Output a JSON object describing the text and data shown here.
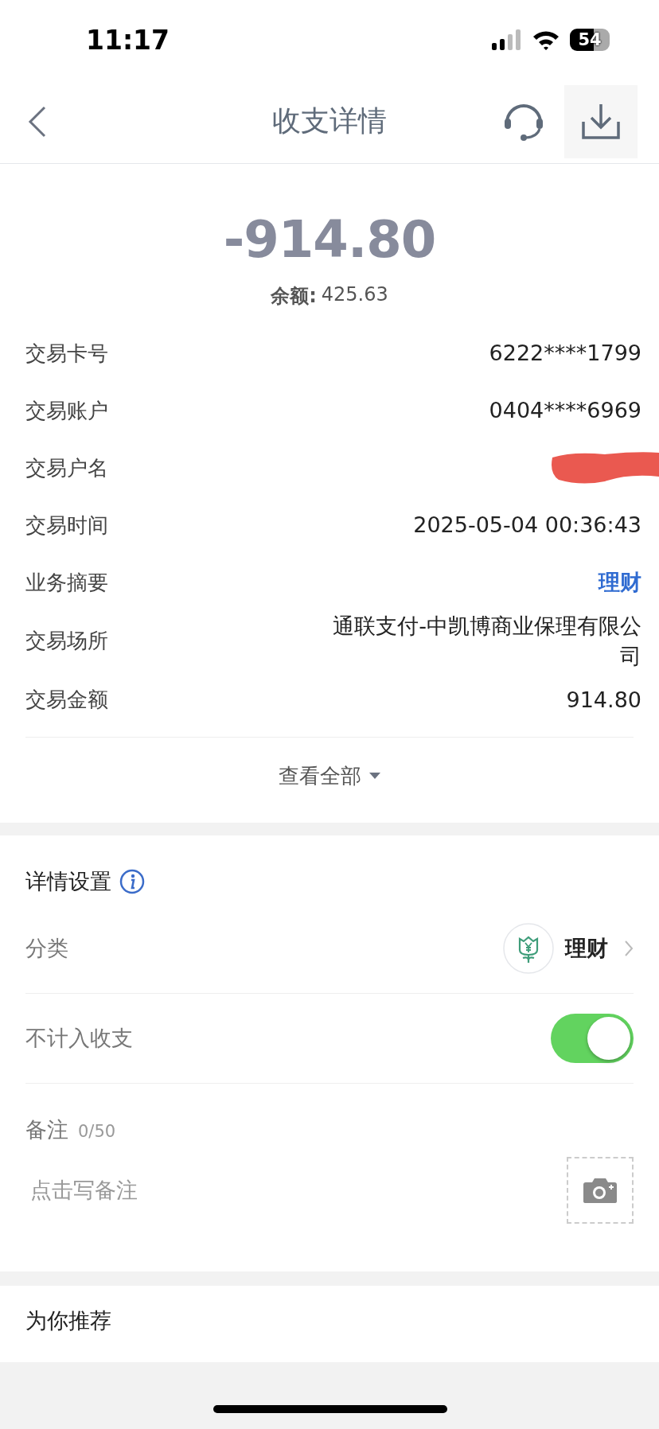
{
  "status_bar": {
    "time": "11:17",
    "battery": "54"
  },
  "nav": {
    "title": "收支详情"
  },
  "summary": {
    "amount": "-914.80",
    "balance_label": "余额:",
    "balance": "425.63"
  },
  "details": [
    {
      "label": "交易卡号",
      "value": "6222****1799",
      "kind": "text"
    },
    {
      "label": "交易账户",
      "value": "0404****6969",
      "kind": "text"
    },
    {
      "label": "交易户名",
      "kind": "redacted"
    },
    {
      "label": "交易时间",
      "value": "2025-05-04 00:36:43",
      "kind": "text"
    },
    {
      "label": "业务摘要",
      "value": "理财",
      "kind": "link"
    },
    {
      "label": "交易场所",
      "value": "通联支付-中凯博商业保理有限公司",
      "kind": "text"
    },
    {
      "label": "交易金额",
      "value": "914.80",
      "kind": "text"
    }
  ],
  "view_all": "查看全部",
  "settings": {
    "title": "详情设置",
    "category_label": "分类",
    "category": "理财",
    "exclude_label": "不计入收支",
    "exclude_on": true,
    "note_label": "备注",
    "note_count": "0/50",
    "note_placeholder": "点击写备注"
  },
  "recommend": {
    "title": "为你推荐"
  }
}
